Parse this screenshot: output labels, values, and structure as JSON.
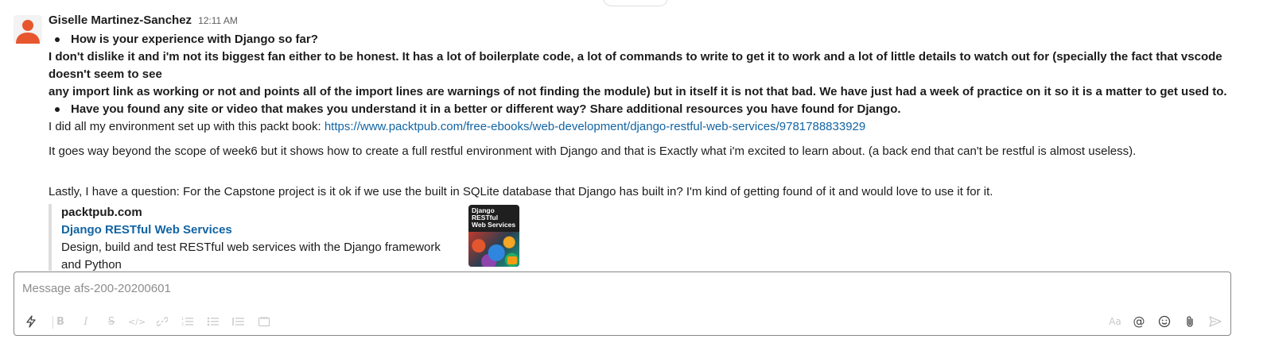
{
  "message": {
    "author": "Giselle Martinez-Sanchez",
    "time": "12:11 AM",
    "bullet1": "How is your experience with Django so far?",
    "answer1_line1": "I don't dislike it and i'm not its biggest fan either to be honest. It has a lot of boilerplate code, a lot of commands to write to get it to work and a lot of little details to watch out for (specially the fact that vscode doesn't seem to see",
    "answer1_line2": "any import link as working or not and points all of the import lines are warnings of not finding the module) but in itself it is not that bad. We have just had a week of practice on it so it is a matter to get used to.",
    "bullet2": "Have you found any site or video that makes you understand it in a better or different way? Share additional resources you have found for Django.",
    "answer2_prefix": "I did all my environment set up with this packt book: ",
    "answer2_link": "https://www.packtpub.com/free-ebooks/web-development/django-restful-web-services/9781788833929",
    "para3": "It goes way beyond the scope of week6 but it shows how to create a full restful environment with Django and that is Exactly what i'm excited to learn about. (a back end that can't be restful is almost useless).",
    "para4": "Lastly, I have a question: For the Capstone project is it ok if we use the built in SQLite database that Django has built in? I'm kind of getting found of it and would love to use it for it.",
    "unfurl": {
      "site": "packtpub.com",
      "title": "Django RESTful Web Services",
      "description": "Design, build and test RESTful web services with the Django framework and Python",
      "thumb_title_lines": [
        "Django",
        "RESTful",
        "Web Services"
      ]
    }
  },
  "composer": {
    "placeholder": "Message afs-200-20200601",
    "icons": [
      "shortcuts-icon",
      "bold-icon",
      "italic-icon",
      "strikethrough-icon",
      "code-icon",
      "link-icon",
      "ordered-list-icon",
      "bulleted-list-icon",
      "blockquote-icon",
      "code-block-icon",
      "format-toggle-icon",
      "mention-icon",
      "emoji-icon",
      "attach-icon",
      "send-icon"
    ],
    "format_toggle_label": "Aa",
    "mention_label": "@"
  },
  "colors": {
    "link": "#1264a3",
    "avatar": "#e8562e",
    "text": "#1d1c1d",
    "muted": "#616061"
  }
}
